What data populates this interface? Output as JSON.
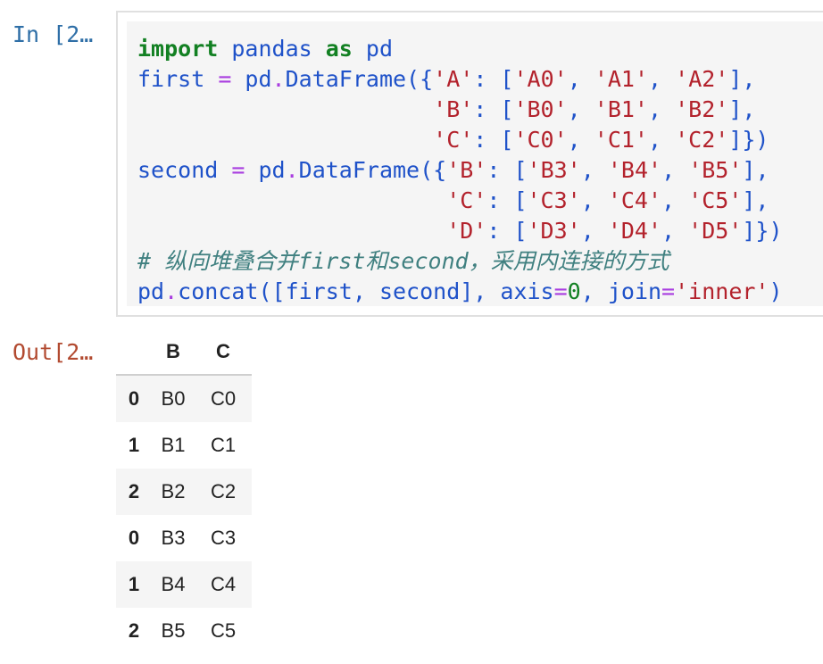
{
  "notebook": {
    "in_prompt": "In [2…",
    "out_prompt": "Out[2…"
  },
  "code": {
    "lines": [
      [
        [
          "kw",
          "import"
        ],
        [
          "tx",
          " pandas "
        ],
        [
          "kw",
          "as"
        ],
        [
          "tx",
          " pd"
        ]
      ],
      [
        [
          "tx",
          "first "
        ],
        [
          "op",
          "="
        ],
        [
          "tx",
          " pd"
        ],
        [
          "op",
          "."
        ],
        [
          "tx",
          "DataFrame({"
        ],
        [
          "str",
          "'A'"
        ],
        [
          "tx",
          ": ["
        ],
        [
          "str",
          "'A0'"
        ],
        [
          "tx",
          ", "
        ],
        [
          "str",
          "'A1'"
        ],
        [
          "tx",
          ", "
        ],
        [
          "str",
          "'A2'"
        ],
        [
          "tx",
          "],"
        ]
      ],
      [
        [
          "tx",
          "                      "
        ],
        [
          "str",
          "'B'"
        ],
        [
          "tx",
          ": ["
        ],
        [
          "str",
          "'B0'"
        ],
        [
          "tx",
          ", "
        ],
        [
          "str",
          "'B1'"
        ],
        [
          "tx",
          ", "
        ],
        [
          "str",
          "'B2'"
        ],
        [
          "tx",
          "],"
        ]
      ],
      [
        [
          "tx",
          "                      "
        ],
        [
          "str",
          "'C'"
        ],
        [
          "tx",
          ": ["
        ],
        [
          "str",
          "'C0'"
        ],
        [
          "tx",
          ", "
        ],
        [
          "str",
          "'C1'"
        ],
        [
          "tx",
          ", "
        ],
        [
          "str",
          "'C2'"
        ],
        [
          "tx",
          "]})"
        ]
      ],
      [
        [
          "tx",
          "second "
        ],
        [
          "op",
          "="
        ],
        [
          "tx",
          " pd"
        ],
        [
          "op",
          "."
        ],
        [
          "tx",
          "DataFrame({"
        ],
        [
          "str",
          "'B'"
        ],
        [
          "tx",
          ": ["
        ],
        [
          "str",
          "'B3'"
        ],
        [
          "tx",
          ", "
        ],
        [
          "str",
          "'B4'"
        ],
        [
          "tx",
          ", "
        ],
        [
          "str",
          "'B5'"
        ],
        [
          "tx",
          "],"
        ]
      ],
      [
        [
          "tx",
          "                       "
        ],
        [
          "str",
          "'C'"
        ],
        [
          "tx",
          ": ["
        ],
        [
          "str",
          "'C3'"
        ],
        [
          "tx",
          ", "
        ],
        [
          "str",
          "'C4'"
        ],
        [
          "tx",
          ", "
        ],
        [
          "str",
          "'C5'"
        ],
        [
          "tx",
          "],"
        ]
      ],
      [
        [
          "tx",
          "                       "
        ],
        [
          "str",
          "'D'"
        ],
        [
          "tx",
          ": ["
        ],
        [
          "str",
          "'D3'"
        ],
        [
          "tx",
          ", "
        ],
        [
          "str",
          "'D4'"
        ],
        [
          "tx",
          ", "
        ],
        [
          "str",
          "'D5'"
        ],
        [
          "tx",
          "]})"
        ]
      ],
      [
        [
          "cm",
          "# 纵向堆叠合并first和second，采用内连接的方式"
        ]
      ],
      [
        [
          "tx",
          "pd"
        ],
        [
          "op",
          "."
        ],
        [
          "tx",
          "concat([first, second], axis"
        ],
        [
          "op",
          "="
        ],
        [
          "num",
          "0"
        ],
        [
          "tx",
          ", join"
        ],
        [
          "op",
          "="
        ],
        [
          "str",
          "'inner'"
        ],
        [
          "tx",
          ")"
        ]
      ]
    ]
  },
  "output": {
    "columns": [
      "",
      "B",
      "C"
    ],
    "rows": [
      {
        "index": "0",
        "B": "B0",
        "C": "C0"
      },
      {
        "index": "1",
        "B": "B1",
        "C": "C1"
      },
      {
        "index": "2",
        "B": "B2",
        "C": "C2"
      },
      {
        "index": "0",
        "B": "B3",
        "C": "C3"
      },
      {
        "index": "1",
        "B": "B4",
        "C": "C4"
      },
      {
        "index": "2",
        "B": "B5",
        "C": "C5"
      }
    ]
  }
}
